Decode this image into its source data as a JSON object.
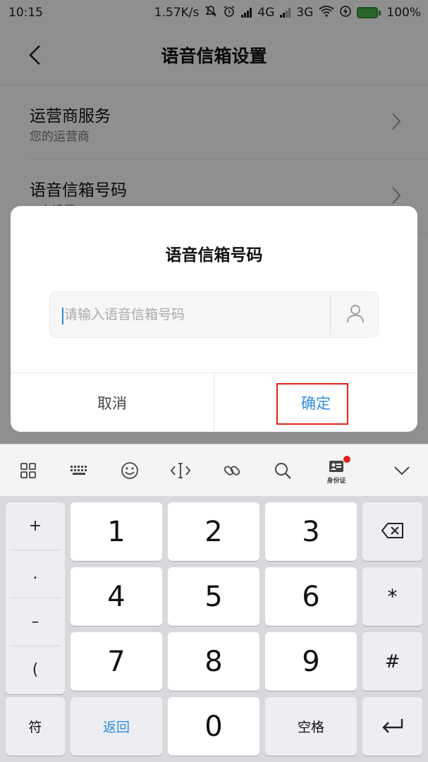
{
  "status_bar": {
    "time": "10:15",
    "net_speed": "1.57K/s",
    "network_4g": "4G",
    "network_3g": "3G",
    "battery": "100%"
  },
  "header": {
    "title": "语音信箱设置"
  },
  "settings": [
    {
      "title": "运营商服务",
      "subtitle": "您的运营商"
    },
    {
      "title": "语音信箱号码",
      "subtitle": "<未设置>"
    }
  ],
  "dialog": {
    "title": "语音信箱号码",
    "input_placeholder": "请输入语音信箱号码",
    "input_value": "",
    "cancel_label": "取消",
    "ok_label": "确定"
  },
  "keyboard_toolbar": {
    "idcard_label": "身份证"
  },
  "keypad": {
    "side_keys": [
      "+",
      ".",
      "–",
      "("
    ],
    "digits": [
      "1",
      "2",
      "3",
      "4",
      "5",
      "6",
      "7",
      "8",
      "9",
      "0"
    ],
    "star": "*",
    "hash": "#",
    "symbol_label": "符",
    "return_label": "返回",
    "space_label": "空格"
  },
  "colors": {
    "accent": "#2f8ae0",
    "highlight_box": "#e2231a",
    "battery": "#4caf50"
  }
}
